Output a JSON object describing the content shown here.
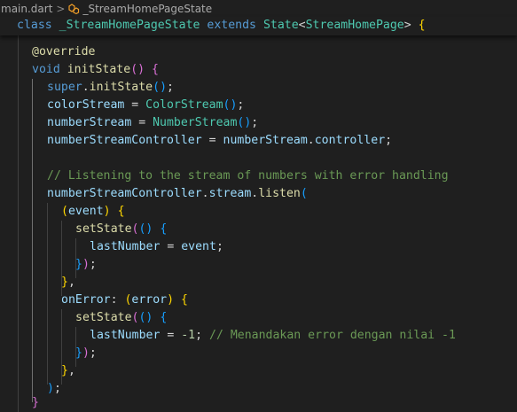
{
  "breadcrumb": {
    "file": "main.dart",
    "separator": ">",
    "symbol": "_StreamHomePageState",
    "symbol_icon": "class-icon"
  },
  "sticky_line": {
    "kw_class": "class",
    "class_name": "_StreamHomePageState",
    "kw_extends": "extends",
    "base": "State",
    "lt": "<",
    "generic": "StreamHomePage",
    "gt": ">",
    "space": " ",
    "brace": "{"
  },
  "code": {
    "l1": {
      "annotation": "@override"
    },
    "l2": {
      "kw": "void",
      "name": "initState",
      "parens": "()",
      "brace": "{"
    },
    "l3": {
      "kw": "super",
      "dot": ".",
      "call": "initState",
      "parens": "()",
      "semi": ";"
    },
    "l4": {
      "var": "colorStream",
      "eq": " = ",
      "type": "ColorStream",
      "parens": "()",
      "semi": ";"
    },
    "l5": {
      "var": "numberStream",
      "eq": " = ",
      "type": "NumberStream",
      "parens": "()",
      "semi": ";"
    },
    "l6": {
      "var": "numberStreamController",
      "eq": " = ",
      "obj": "numberStream",
      "dot": ".",
      "prop": "controller",
      "semi": ";"
    },
    "l7": {
      "comment": "// Listening to the stream of numbers with error handling"
    },
    "l8": {
      "obj": "numberStreamController",
      "dot1": ".",
      "prop": "stream",
      "dot2": ".",
      "call": "listen",
      "paren": "("
    },
    "l9": {
      "open": "(",
      "param": "event",
      "close": ")",
      "brace": "{"
    },
    "l10": {
      "call": "setState",
      "open": "(",
      "args": "()",
      "brace": "{"
    },
    "l11": {
      "var": "lastNumber",
      "eq": " = ",
      "val": "event",
      "semi": ";"
    },
    "l12": {
      "brace": "}",
      "paren": ")",
      "semi": ";"
    },
    "l13": {
      "brace": "}",
      "comma": ","
    },
    "l14": {
      "name": "onError",
      "colon": ": ",
      "open": "(",
      "param": "error",
      "close": ")",
      "brace": "{"
    },
    "l15": {
      "call": "setState",
      "open": "(",
      "args": "()",
      "brace": "{"
    },
    "l16": {
      "var": "lastNumber",
      "eq": " = ",
      "num": "-1",
      "semi": ";",
      "comment": "// Menandakan error dengan nilai -1"
    },
    "l17": {
      "brace": "}",
      "paren": ")",
      "semi": ";"
    },
    "l18": {
      "brace": "}",
      "comma": ","
    },
    "l19": {
      "paren": ")",
      "semi": ";"
    },
    "l20": {
      "brace": "}"
    }
  }
}
